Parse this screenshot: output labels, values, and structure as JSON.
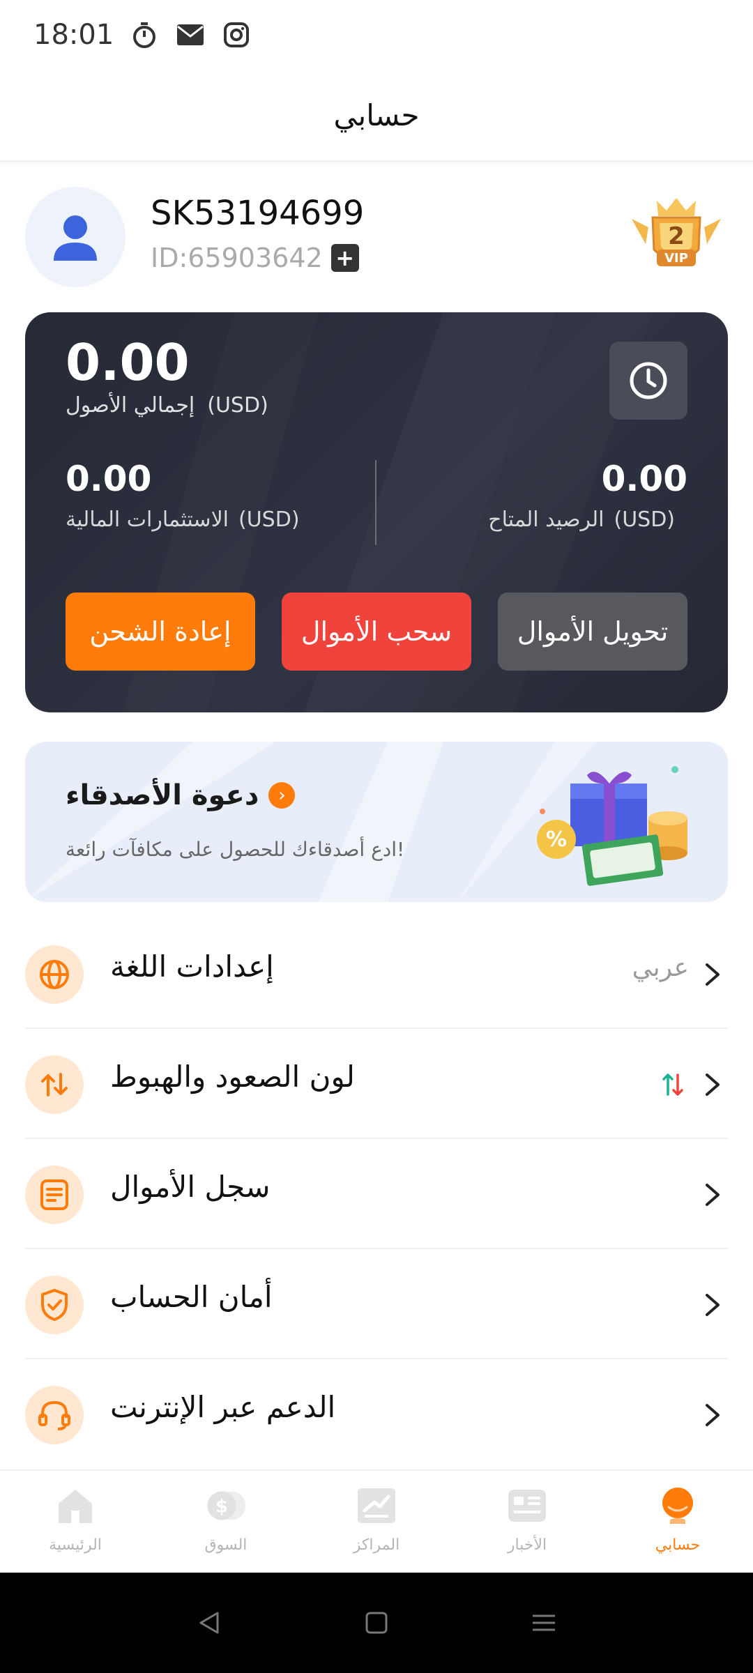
{
  "status_bar": {
    "time": "18:01",
    "icons": [
      "timer-icon",
      "mail-icon",
      "instagram-icon"
    ]
  },
  "header": {
    "title": "حسابي"
  },
  "profile": {
    "username": "SK53194699",
    "user_id": "ID:65903642",
    "vip_level": "2",
    "vip_label": "VIP"
  },
  "assets": {
    "total_value": "0.00",
    "total_label": "إجمالي الأصول",
    "currency": "(USD)",
    "available_value": "0.00",
    "available_label": "الرصيد المتاح",
    "investments_value": "0.00",
    "investments_label": "الاستثمارات المالية",
    "buttons": {
      "recharge": "إعادة الشحن",
      "withdraw": "سحب الأموال",
      "transfer": "تحويل الأموال"
    }
  },
  "invite": {
    "title": "دعوة الأصدقاء",
    "subtitle": "ادع أصدقاءك للحصول على مكافآت رائعة!"
  },
  "menu": [
    {
      "label": "إعدادات اللغة",
      "value": "عربي",
      "icon": "globe-icon"
    },
    {
      "label": "لون الصعود والهبوط",
      "value": "",
      "icon": "up-down-arrows-icon"
    },
    {
      "label": "سجل الأموال",
      "value": "",
      "icon": "document-icon"
    },
    {
      "label": "أمان الحساب",
      "value": "",
      "icon": "shield-check-icon"
    },
    {
      "label": "الدعم عبر الإنترنت",
      "value": "",
      "icon": "headset-icon"
    }
  ],
  "bottom_nav": [
    {
      "label": "الرئيسية",
      "icon": "home-icon",
      "active": false
    },
    {
      "label": "السوق",
      "icon": "market-coin-icon",
      "active": false
    },
    {
      "label": "المراكز",
      "icon": "positions-icon",
      "active": false
    },
    {
      "label": "الأخبار",
      "icon": "news-icon",
      "active": false
    },
    {
      "label": "حسابي",
      "icon": "profile-icon",
      "active": true
    }
  ],
  "colors": {
    "accent": "#ff7c0a",
    "withdraw": "#f0433c",
    "transfer": "#58595f",
    "card_bg": "#2b2e3a",
    "up_color": "#19b394",
    "down_color": "#f0433c"
  }
}
